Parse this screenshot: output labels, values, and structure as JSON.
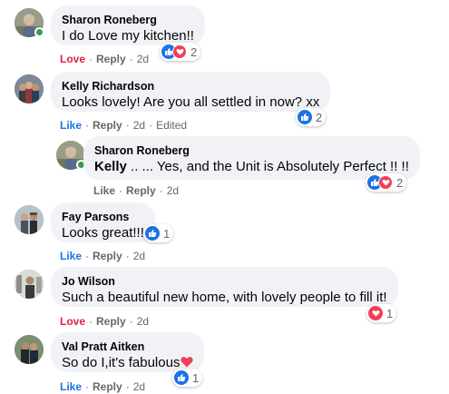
{
  "comments": [
    {
      "author": "Sharon Roneberg",
      "text": "I do Love my kitchen!!",
      "reaction_label": "Love",
      "reply_label": "Reply",
      "time": "2d",
      "reactions_count": "2",
      "reaction_icons": [
        "like-icon",
        "love-icon"
      ],
      "online": true
    },
    {
      "author": "Kelly Richardson",
      "text": "Looks lovely! Are you all settled in now? xx",
      "reaction_label": "Like",
      "reply_label": "Reply",
      "time": "2d",
      "edited": "Edited",
      "reactions_count": "2",
      "reaction_icons": [
        "like-icon"
      ]
    },
    {
      "author": "Sharon Roneberg",
      "mention": "Kelly",
      "text": " .. ... Yes, and the Unit is Absolutely Perfect !! !!",
      "reaction_label": "Like",
      "reply_label": "Reply",
      "time": "2d",
      "reactions_count": "2",
      "reaction_icons": [
        "like-icon",
        "love-icon"
      ],
      "is_reply": true
    },
    {
      "author": "Fay Parsons",
      "text": "Looks great!!!",
      "reaction_label": "Like",
      "reply_label": "Reply",
      "time": "2d",
      "reactions_count": "1",
      "reaction_icons": [
        "like-icon"
      ]
    },
    {
      "author": "Jo Wilson",
      "text": "Such a beautiful new home, with lovely people to fill it!",
      "reaction_label": "Love",
      "reply_label": "Reply",
      "time": "2d",
      "reactions_count": "1",
      "reaction_icons": [
        "love-icon"
      ]
    },
    {
      "author": "Val Pratt Aitken",
      "text": "So do I,it's fabulous",
      "reaction_label": "Like",
      "reply_label": "Reply",
      "time": "2d",
      "reactions_count": "1",
      "reaction_icons": [
        "like-icon"
      ],
      "trailing_emoji": "heart-emoji-icon"
    }
  ],
  "colors": {
    "bubble_bg": "#f0f2f5",
    "like_blue": "#1b74e4",
    "love_red": "#e41e3f",
    "meta_gray": "#65676b",
    "online_green": "#31a24c"
  }
}
